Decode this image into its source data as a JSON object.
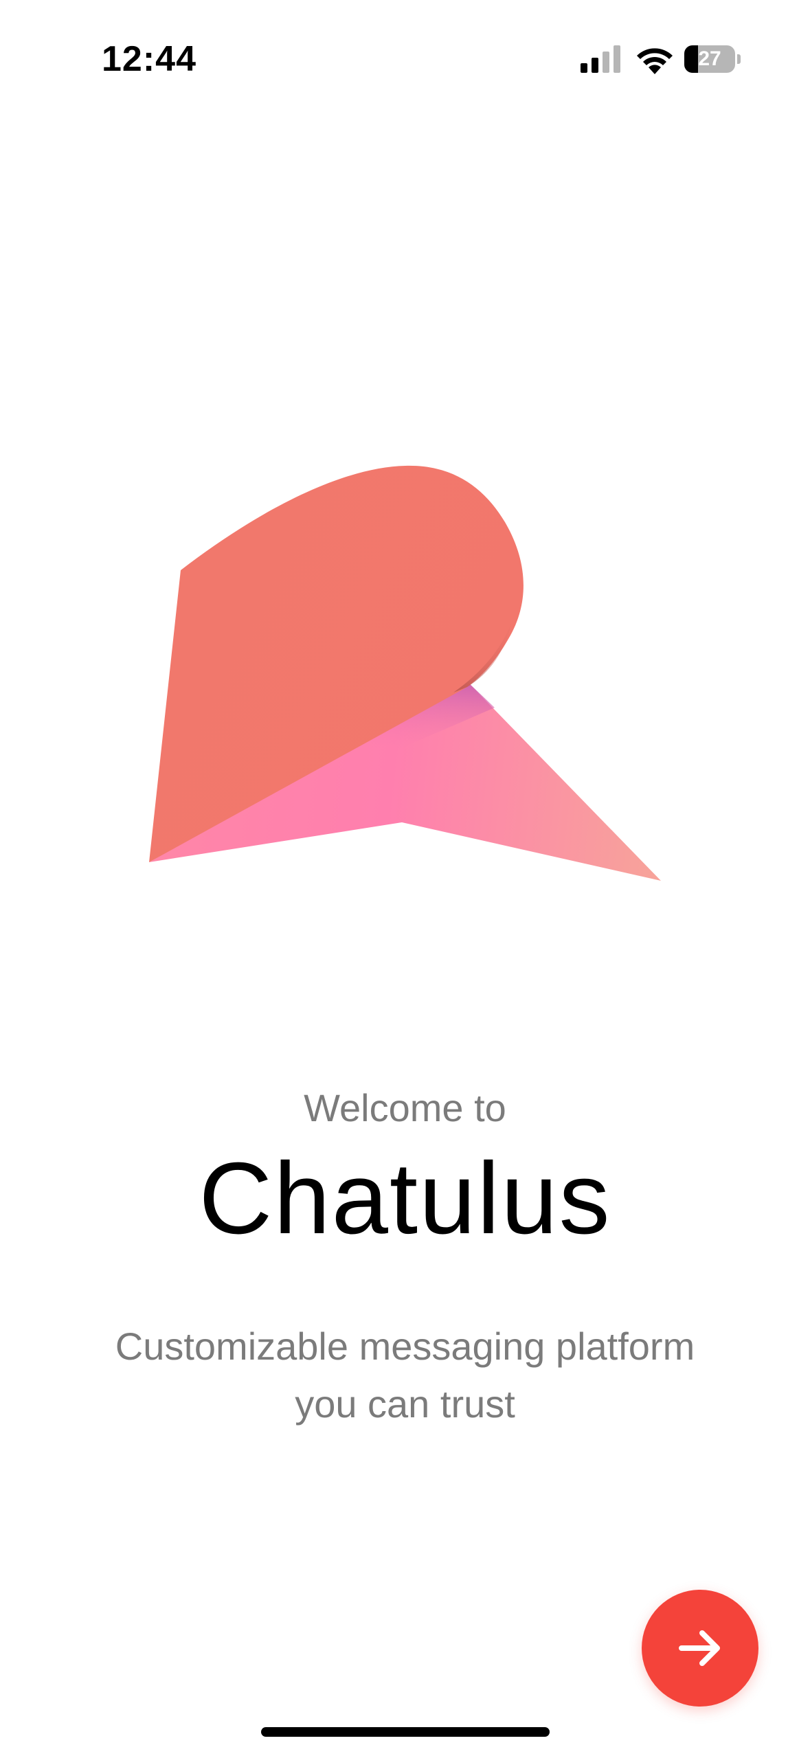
{
  "status_bar": {
    "time": "12:44",
    "battery_level": "27",
    "signal_icon": "cellular-signal-icon",
    "wifi_icon": "wifi-icon",
    "battery_icon": "battery-icon"
  },
  "logo": {
    "icon": "chatulus-logo",
    "colors": {
      "coral": "#f2776c",
      "pink": "#ff7eac",
      "peach": "#f7a39a"
    }
  },
  "welcome": {
    "intro": "Welcome to",
    "app_name": "Chatulus",
    "tagline_line1": "Customizable messaging platform",
    "tagline_line2": "you can trust"
  },
  "next_button": {
    "icon": "arrow-right-icon",
    "color": "#f4433a"
  }
}
